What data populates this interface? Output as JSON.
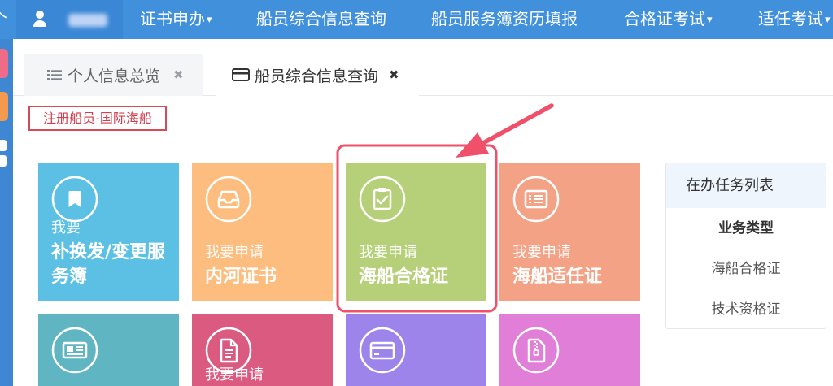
{
  "theme": {
    "nav_color": "#4190dc",
    "nav_user_area_color": "#3a87d6",
    "sidebar_color": "#3f86d3"
  },
  "topnav": {
    "clipped_glyph": "个",
    "user_icon": "user-icon",
    "items": [
      {
        "label": "证书申办",
        "caret": "▾"
      },
      {
        "label": "船员综合信息查询",
        "caret": ""
      },
      {
        "label": "船员服务簿资历填报",
        "caret": ""
      },
      {
        "label": "合格证考试",
        "caret": "▾"
      },
      {
        "label": "适任考试",
        "caret": "▾"
      }
    ]
  },
  "sidebar": {
    "icons": [
      "app-icon-pink",
      "app-icon-orange",
      "grid-icon"
    ]
  },
  "tabs": [
    {
      "icon": "list-icon",
      "label": "个人信息总览",
      "close": "✖"
    },
    {
      "icon": "card-icon",
      "label": "船员综合信息查询",
      "close": "✖"
    }
  ],
  "status_badge": "注册船员-国际海船",
  "tiles": [
    {
      "icon": "bookmark-icon",
      "prefix": "我要",
      "title": "补换发/变更服务簿",
      "color": "#5cc0e4"
    },
    {
      "icon": "tray-icon",
      "prefix": "我要申请",
      "title": "内河证书",
      "color": "#fcbd7e"
    },
    {
      "icon": "clipboard-check-icon",
      "prefix": "我要申请",
      "title": "海船合格证",
      "color": "#b6d07a"
    },
    {
      "icon": "list-document-icon",
      "prefix": "我要申请",
      "title": "海船适任证",
      "color": "#f4a285"
    },
    {
      "icon": "newspaper-icon",
      "prefix": "",
      "title": "",
      "color": "#60b5c3"
    },
    {
      "icon": "document-icon",
      "prefix": "我要申请",
      "title": "",
      "color": "#db5b80"
    },
    {
      "icon": "credit-card-icon",
      "prefix": "",
      "title": "",
      "color": "#9c84ea"
    },
    {
      "icon": "zip-file-icon",
      "prefix": "",
      "title": "",
      "color": "#e07ed8"
    }
  ],
  "task_panel": {
    "title": "在办任务列表",
    "column_header": "业务类型",
    "rows": [
      "海船合格证",
      "技术资格证"
    ]
  },
  "annotation": {
    "color": "#f0506a"
  }
}
